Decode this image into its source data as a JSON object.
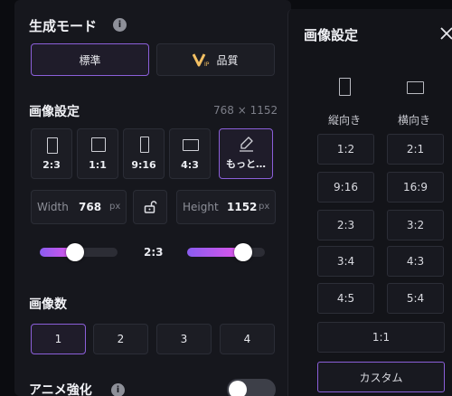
{
  "settings": {
    "mode_title": "生成モード",
    "info_icon": "i",
    "mode_standard": "標準",
    "mode_quality": "品質",
    "image_settings": "画像設定",
    "resolution": "768 × 1152",
    "ratios": [
      "2:3",
      "1:1",
      "9:16",
      "4:3",
      "もっと…"
    ],
    "width_label": "Width",
    "width_value": "768",
    "height_label": "Height",
    "height_value": "1152",
    "unit": "px",
    "slider_ratio": "2:3",
    "width_slider_level": 0.45,
    "height_slider_level": 0.72,
    "count_title": "画像数",
    "counts": [
      "1",
      "2",
      "3",
      "4"
    ],
    "selected_count": "1",
    "anime_title": "アニメ強化",
    "anime_enabled": false
  },
  "drawer": {
    "title": "画像設定",
    "close_icon": "close-icon",
    "portrait": "縦向き",
    "landscape": "横向き",
    "ratios_left": [
      "1:2",
      "9:16",
      "2:3",
      "3:4",
      "4:5"
    ],
    "ratios_right": [
      "2:1",
      "16:9",
      "3:2",
      "4:3",
      "5:4"
    ],
    "square": "1:1",
    "custom": "カスタム"
  },
  "colors": {
    "accent": "#8b5fd9",
    "panel": "#16171d",
    "background": "#0b0c10"
  }
}
